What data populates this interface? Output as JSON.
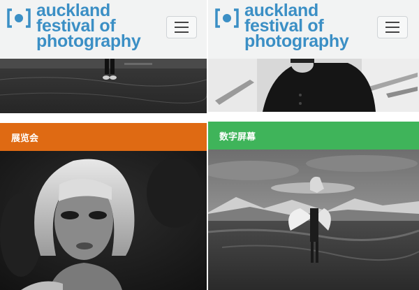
{
  "brand": {
    "line1": "auckland",
    "line2": "festival of",
    "line3": "photography",
    "color": "#3b8fc5"
  },
  "panels": [
    {
      "category": "展览会",
      "band_color": "#df6a13"
    },
    {
      "category": "数字屏幕",
      "band_color": "#3fb45a"
    }
  ],
  "icons": {
    "menu": "hamburger-menu-icon",
    "logo": "bracket-dot-logo-icon"
  }
}
